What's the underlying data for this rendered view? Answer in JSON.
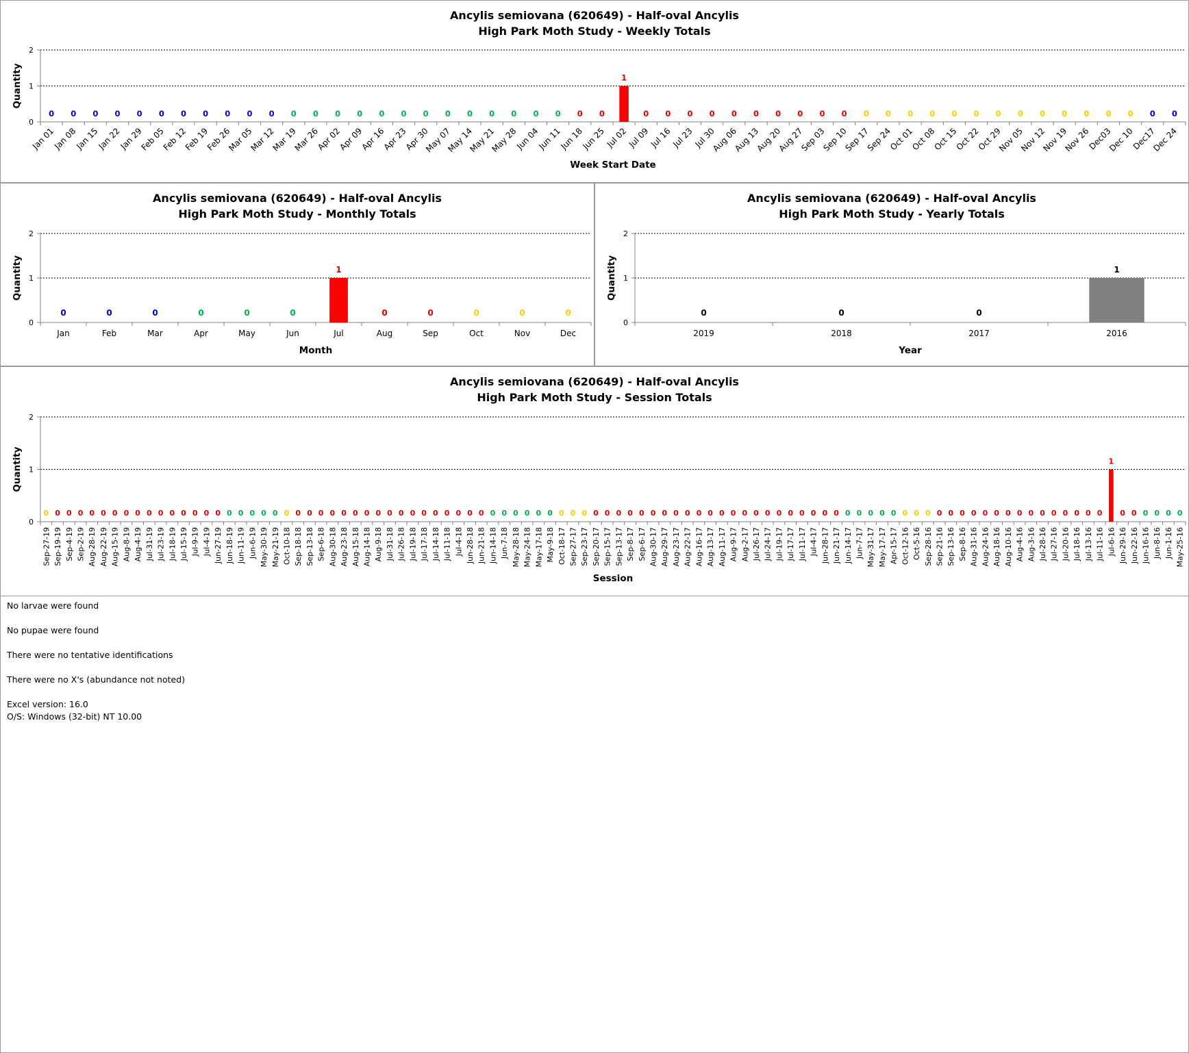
{
  "colors": {
    "winter": "#0000cc",
    "spring": "#00b050",
    "summer": "#e00000",
    "autumn": "#ffcc00",
    "bar_red": "#ff0000",
    "bar_gray": "#808080",
    "year_label": "#000000"
  },
  "chart_data": [
    {
      "id": "weekly",
      "type": "bar",
      "title_line1": "Ancylis semiovana (620649)  - Half-oval Ancylis",
      "title_line2": "High Park Moth Study  -  Weekly Totals",
      "xlabel": "Week Start Date",
      "ylabel": "Quantity",
      "ylim": [
        0,
        2
      ],
      "yticks": [
        "0",
        "1",
        "2"
      ],
      "grid": "horizontal dotted",
      "legend": "none",
      "categories": [
        "Jan 01",
        "Jan 08",
        "Jan 15",
        "Jan 22",
        "Jan 29",
        "Feb 05",
        "Feb 12",
        "Feb 19",
        "Feb 26",
        "Mar 05",
        "Mar 12",
        "Mar 19",
        "Mar 26",
        "Apr 02",
        "Apr 09",
        "Apr 16",
        "Apr 23",
        "Apr 30",
        "May 07",
        "May 14",
        "May 21",
        "May 28",
        "Jun 04",
        "Jun 11",
        "Jun 18",
        "Jun 25",
        "Jul 02",
        "Jul 09",
        "Jul 16",
        "Jul 23",
        "Jul 30",
        "Aug 06",
        "Aug 13",
        "Aug 20",
        "Aug 27",
        "Sep 03",
        "Sep 10",
        "Sep 17",
        "Sep 24",
        "Oct 01",
        "Oct 08",
        "Oct 15",
        "Oct 22",
        "Oct 29",
        "Nov 05",
        "Nov 12",
        "Nov 19",
        "Nov 26",
        "Dec03",
        "Dec 10",
        "Dec17",
        "Dec 24"
      ],
      "values": [
        0,
        0,
        0,
        0,
        0,
        0,
        0,
        0,
        0,
        0,
        0,
        0,
        0,
        0,
        0,
        0,
        0,
        0,
        0,
        0,
        0,
        0,
        0,
        0,
        0,
        0,
        1,
        0,
        0,
        0,
        0,
        0,
        0,
        0,
        0,
        0,
        0,
        0,
        0,
        0,
        0,
        0,
        0,
        0,
        0,
        0,
        0,
        0,
        0,
        0,
        0,
        0
      ],
      "label_colors": [
        "winter",
        "winter",
        "winter",
        "winter",
        "winter",
        "winter",
        "winter",
        "winter",
        "winter",
        "winter",
        "winter",
        "spring",
        "spring",
        "spring",
        "spring",
        "spring",
        "spring",
        "spring",
        "spring",
        "spring",
        "spring",
        "spring",
        "spring",
        "spring",
        "summer",
        "summer",
        "summer",
        "summer",
        "summer",
        "summer",
        "summer",
        "summer",
        "summer",
        "summer",
        "summer",
        "summer",
        "summer",
        "autumn",
        "autumn",
        "autumn",
        "autumn",
        "autumn",
        "autumn",
        "autumn",
        "autumn",
        "autumn",
        "autumn",
        "autumn",
        "autumn",
        "autumn",
        "winter",
        "winter"
      ]
    },
    {
      "id": "monthly",
      "type": "bar",
      "title_line1": "Ancylis semiovana (620649)  - Half-oval Ancylis",
      "title_line2": "High Park Moth Study  -  Monthly Totals",
      "xlabel": "Month",
      "ylabel": "Quantity",
      "ylim": [
        0,
        2
      ],
      "yticks": [
        "0",
        "1",
        "2"
      ],
      "grid": "horizontal dotted",
      "legend": "none",
      "categories": [
        "Jan",
        "Feb",
        "Mar",
        "Apr",
        "May",
        "Jun",
        "Jul",
        "Aug",
        "Sep",
        "Oct",
        "Nov",
        "Dec"
      ],
      "values": [
        0,
        0,
        0,
        0,
        0,
        0,
        1,
        0,
        0,
        0,
        0,
        0
      ],
      "label_colors": [
        "winter",
        "winter",
        "winter",
        "spring",
        "spring",
        "spring",
        "summer",
        "summer",
        "summer",
        "autumn",
        "autumn",
        "autumn"
      ]
    },
    {
      "id": "yearly",
      "type": "bar",
      "title_line1": "Ancylis semiovana (620649)  - Half-oval Ancylis",
      "title_line2": "High Park Moth Study  -  Yearly Totals",
      "xlabel": "Year",
      "ylabel": "Quantity",
      "ylim": [
        0,
        2
      ],
      "yticks": [
        "0",
        "1",
        "2"
      ],
      "grid": "horizontal dotted",
      "legend": "none",
      "categories": [
        "2019",
        "2018",
        "2017",
        "2016"
      ],
      "values": [
        0,
        0,
        0,
        1
      ],
      "label_colors": [
        "year_label",
        "year_label",
        "year_label",
        "year_label"
      ]
    },
    {
      "id": "session",
      "type": "bar",
      "title_line1": "Ancylis semiovana (620649)  - Half-oval Ancylis",
      "title_line2": "High Park Moth Study  -  Session Totals",
      "xlabel": "Session",
      "ylabel": "Quantity",
      "ylim": [
        0,
        2
      ],
      "yticks": [
        "0",
        "1",
        "2"
      ],
      "grid": "horizontal dotted",
      "legend": "none",
      "categories": [
        "Sep-27-19",
        "Sep-19-19",
        "Sep-4-19",
        "Sep-2-19",
        "Aug-28-19",
        "Aug-22-19",
        "Aug-15-19",
        "Aug-8-19",
        "Aug-4-19",
        "Jul-31-19",
        "Jul-23-19",
        "Jul-18-19",
        "Jul-15-19",
        "Jul-9-19",
        "Jul-4-19",
        "Jun-27-19",
        "Jun-18-19",
        "Jun-11-19",
        "Jun-6-19",
        "May-30-19",
        "May-21-19",
        "Oct-10-18",
        "Sep-18-18",
        "Sep-13-18",
        "Sep-6-18",
        "Aug-30-18",
        "Aug-23-18",
        "Aug-15-18",
        "Aug-14-18",
        "Aug-9-18",
        "Jul-31-18",
        "Jul-26-18",
        "Jul-19-18",
        "Jul-17-18",
        "Jul-14-18",
        "Jul-11-18",
        "Jul-4-18",
        "Jun-28-18",
        "Jun-21-18",
        "Jun-14-18",
        "Jun-7-18",
        "May-28-18",
        "May-24-18",
        "May-17-18",
        "May-9-18",
        "Oct-18-17",
        "Sep-27-17",
        "Sep-23-17",
        "Sep-20-17",
        "Sep-15-17",
        "Sep-13-17",
        "Sep-8-17",
        "Sep-6-17",
        "Aug-30-17",
        "Aug-29-17",
        "Aug-23-17",
        "Aug-22-17",
        "Aug-16-17",
        "Aug-13-17",
        "Aug-11-17",
        "Aug-9-17",
        "Aug-2-17",
        "Jul-26-17",
        "Jul-24-17",
        "Jul-19-17",
        "Jul-17-17",
        "Jul-11-17",
        "Jul-4-17",
        "Jun-28-17",
        "Jun-21-17",
        "Jun-14-17",
        "Jun-7-17",
        "May-31-17",
        "May-17-17",
        "Apr-15-17",
        "Oct-12-16",
        "Oct-5-16",
        "Sep-28-16",
        "Sep-21-16",
        "Sep-13-16",
        "Sep-8-16",
        "Aug-31-16",
        "Aug-24-16",
        "Aug-18-16",
        "Aug-10-16",
        "Aug-4-16",
        "Aug-3-16",
        "Jul-28-16",
        "Jul-27-16",
        "Jul-20-16",
        "Jul-18-16",
        "Jul-13-16",
        "Jul-11-16",
        "Jul-6-16",
        "Jun-29-16",
        "Jun-22-16",
        "Jun-16-16",
        "Jun-8-16",
        "Jun-1-16",
        "May-25-16"
      ],
      "values": [
        0,
        0,
        0,
        0,
        0,
        0,
        0,
        0,
        0,
        0,
        0,
        0,
        0,
        0,
        0,
        0,
        0,
        0,
        0,
        0,
        0,
        0,
        0,
        0,
        0,
        0,
        0,
        0,
        0,
        0,
        0,
        0,
        0,
        0,
        0,
        0,
        0,
        0,
        0,
        0,
        0,
        0,
        0,
        0,
        0,
        0,
        0,
        0,
        0,
        0,
        0,
        0,
        0,
        0,
        0,
        0,
        0,
        0,
        0,
        0,
        0,
        0,
        0,
        0,
        0,
        0,
        0,
        0,
        0,
        0,
        0,
        0,
        0,
        0,
        0,
        0,
        0,
        0,
        0,
        0,
        0,
        0,
        0,
        0,
        0,
        0,
        0,
        0,
        0,
        0,
        0,
        0,
        0,
        1,
        0,
        0,
        0,
        0,
        0,
        0
      ],
      "label_colors": [
        "autumn",
        "summer",
        "summer",
        "summer",
        "summer",
        "summer",
        "summer",
        "summer",
        "summer",
        "summer",
        "summer",
        "summer",
        "summer",
        "summer",
        "summer",
        "summer",
        "spring",
        "spring",
        "spring",
        "spring",
        "spring",
        "autumn",
        "summer",
        "summer",
        "summer",
        "summer",
        "summer",
        "summer",
        "summer",
        "summer",
        "summer",
        "summer",
        "summer",
        "summer",
        "summer",
        "summer",
        "summer",
        "summer",
        "summer",
        "spring",
        "spring",
        "spring",
        "spring",
        "spring",
        "spring",
        "autumn",
        "autumn",
        "autumn",
        "summer",
        "summer",
        "summer",
        "summer",
        "summer",
        "summer",
        "summer",
        "summer",
        "summer",
        "summer",
        "summer",
        "summer",
        "summer",
        "summer",
        "summer",
        "summer",
        "summer",
        "summer",
        "summer",
        "summer",
        "summer",
        "summer",
        "spring",
        "spring",
        "spring",
        "spring",
        "spring",
        "autumn",
        "autumn",
        "autumn",
        "summer",
        "summer",
        "summer",
        "summer",
        "summer",
        "summer",
        "summer",
        "summer",
        "summer",
        "summer",
        "summer",
        "summer",
        "summer",
        "summer",
        "summer",
        "summer",
        "summer",
        "summer",
        "spring",
        "spring",
        "spring",
        "spring"
      ]
    }
  ],
  "notes": {
    "larvae": "No larvae were found",
    "pupae": "No pupae were found",
    "tentative": "There were no tentative identifications",
    "xs": "There were no X's (abundance not noted)",
    "excel_version": "Excel version: 16.0",
    "os": "O/S: Windows (32-bit) NT 10.00"
  }
}
